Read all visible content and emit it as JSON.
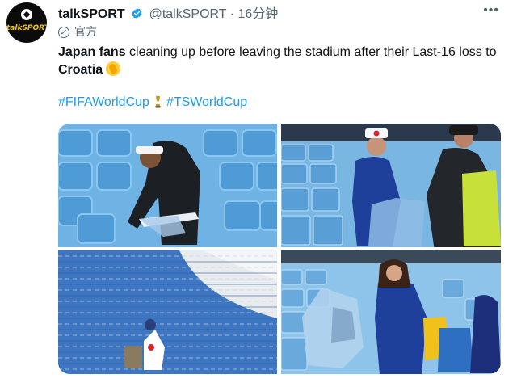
{
  "account": {
    "display_name": "talkSPORT",
    "handle": "@talkSPORT",
    "separator": "·",
    "time": "16分钟",
    "avatar_text": "talkSPORT",
    "label": "官方"
  },
  "tweet": {
    "bold_lead": "Japan fans",
    "text": " cleaning up before leaving the stadium after their Last-16 loss to ",
    "bold_tail": "Croatia",
    "emoji": "clapping-hands"
  },
  "hashtags": {
    "first": "#FIFAWorldCup",
    "second": "#TSWorldCup"
  },
  "media": {
    "photos": [
      "fan-with-headband-collecting-trash",
      "fans-putting-trash-in-bag",
      "child-cleaning-among-seats",
      "woman-holding-trash-bags"
    ]
  },
  "colors": {
    "accent": "#1d9bf0",
    "verified": "#1d9bf0",
    "seat_blue": "#4a8fd8"
  },
  "icons": [
    "verified-badge-icon",
    "more-icon",
    "official-check-icon",
    "clap-emoji-icon",
    "trophy-icon"
  ]
}
